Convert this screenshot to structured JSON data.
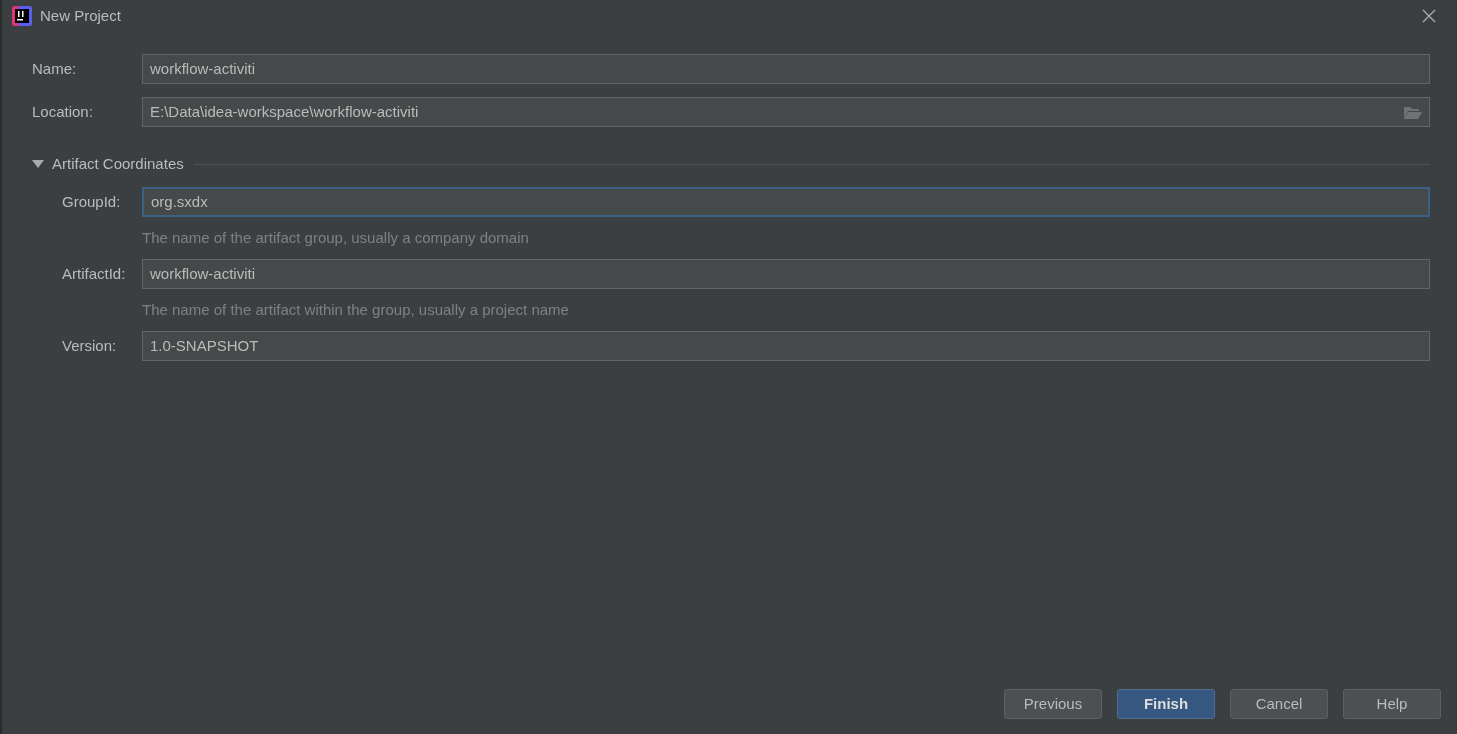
{
  "window": {
    "title": "New Project"
  },
  "fields": [
    {
      "label": "Name:",
      "value": "workflow-activiti",
      "focused": false,
      "browse": false
    },
    {
      "label": "Location:",
      "value": "E:\\Data\\idea-workspace\\workflow-activiti",
      "focused": false,
      "browse": true
    }
  ],
  "section": {
    "title": "Artifact Coordinates",
    "expanded": true,
    "fields": [
      {
        "label": "GroupId:",
        "value": "org.sxdx",
        "focused": true,
        "hint": "The name of the artifact group, usually a company domain"
      },
      {
        "label": "ArtifactId:",
        "value": "workflow-activiti",
        "focused": false,
        "hint": "The name of the artifact within the group, usually a project name"
      },
      {
        "label": "Version:",
        "value": "1.0-SNAPSHOT",
        "focused": false
      }
    ]
  },
  "buttons": [
    {
      "label": "Previous",
      "default": false
    },
    {
      "label": "Finish",
      "default": true
    },
    {
      "label": "Cancel",
      "default": false
    },
    {
      "label": "Help",
      "default": false
    }
  ]
}
